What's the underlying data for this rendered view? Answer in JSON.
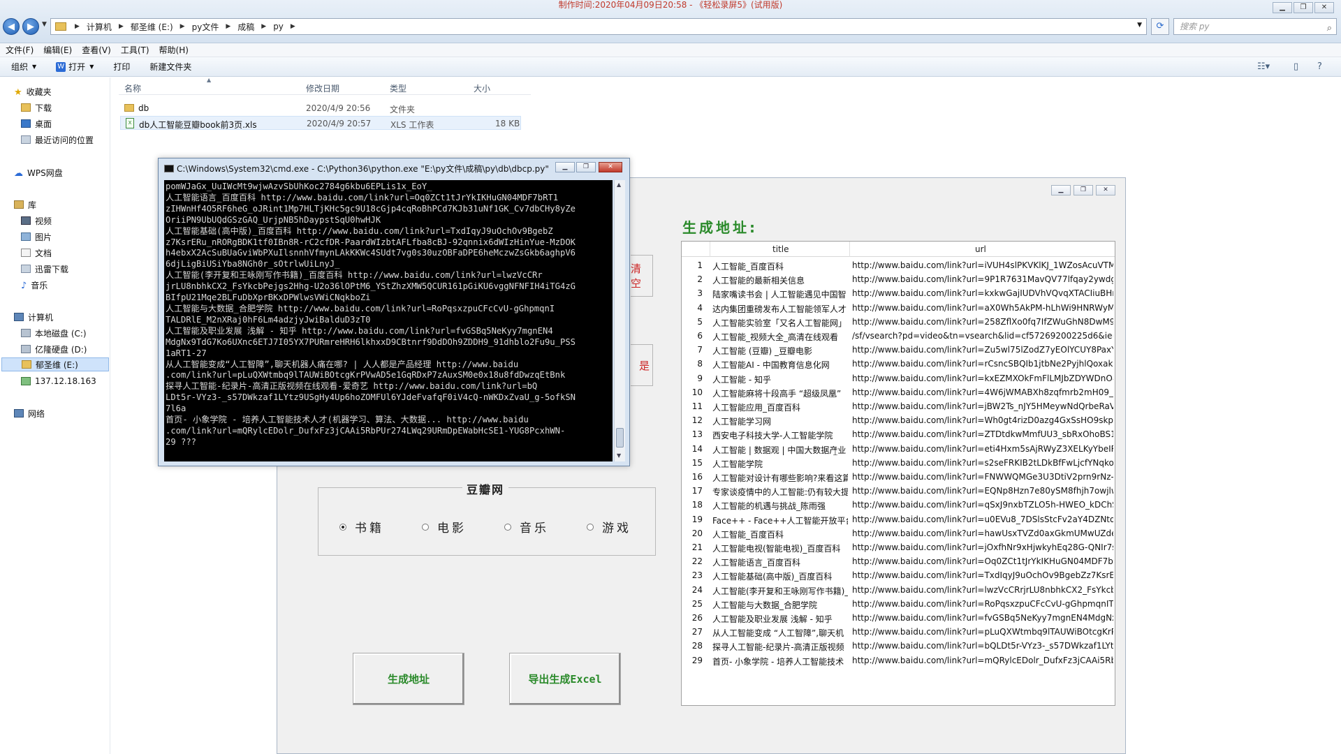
{
  "recording_caption": "制作时间:2020年04月09日20:58 - 《轻松录屏5》(试用版)",
  "explorer": {
    "breadcrumb": [
      "计算机",
      "郁圣维 (E:)",
      "py文件",
      "成稿",
      "py"
    ],
    "search_placeholder": "搜索 py",
    "menu": [
      "文件(F)",
      "编辑(E)",
      "查看(V)",
      "工具(T)",
      "帮助(H)"
    ],
    "toolbar": {
      "organize": "组织",
      "open": "打开",
      "print": "打印",
      "new_folder": "新建文件夹"
    },
    "sidebar": {
      "favorites": "收藏夹",
      "downloads": "下载",
      "desktop": "桌面",
      "recent": "最近访问的位置",
      "wps": "WPS网盘",
      "library": "库",
      "video": "视频",
      "pictures": "图片",
      "documents": "文档",
      "thunder": "迅雷下载",
      "music": "音乐",
      "computer": "计算机",
      "drive_c": "本地磁盘 (C:)",
      "drive_d": "亿隆硬盘 (D:)",
      "drive_e": "郁圣维 (E:)",
      "network_drive": "137.12.18.163",
      "network": "网络"
    },
    "columns": {
      "name": "名称",
      "modified": "修改日期",
      "type": "类型",
      "size": "大小"
    },
    "files": [
      {
        "name": "db",
        "modified": "2020/4/9 20:56",
        "type": "文件夹",
        "size": ""
      },
      {
        "name": "db人工智能豆瓣book前3页.xls",
        "modified": "2020/4/9 20:57",
        "type": "XLS 工作表",
        "size": "18 KB"
      }
    ]
  },
  "cmd": {
    "title": "C:\\Windows\\System32\\cmd.exe - C:\\Python36\\python.exe  \"E:\\py文件\\成稿\\py\\db\\dbcp.py\"",
    "lines": [
      "pomWJaGx_UuIWcMt9wjwAzvSbUhKoc2784g6kbu6EPLis1x_EoY_",
      "人工智能语言_百度百科 http://www.baidu.com/link?url=Oq0ZCt1tJrYkIKHuGN04MDF7bRT1",
      "zIHWnHf4O5RF6heG_oJRint1Mp7HLTjKHc5gc9U18cGjp4cqRoBhPCd7KJb31uNf1GK_Cv7dbCHy8yZe",
      "OriiPN9UbUQdGSzGAQ_UrjpNB5hDaypstSqU0hwHJK",
      "人工智能基础(高中版)_百度百科 http://www.baidu.com/link?url=TxdIqyJ9uOchOv9BgebZ",
      "z7KsrERu_nRORgBDK1tf0IBn8R-rC2cfDR-PaardWIzbtAFLfba8cBJ-92qnnix6dWIzHinYue-MzDOK",
      "h4ebxX2AcSuBUaGviWbPXuIlsnnhVfmynLAkKKWc4SUdt7vg0s30uzOBFaDPE6heMczwZsGkb6aghpV6",
      "6djLigBiUSiYba8NGh0r_sOtrlwUiLnyJ_",
      "人工智能(李开复和王咏刚写作书籍)_百度百科 http://www.baidu.com/link?url=lwzVcCRr",
      "jrLU8nbhkCX2_FsYkcbPejgs2Hhg-U2o36lOPtM6_YStZhzXMW5QCUR161pGiKU6vggNFNFIH4iTG4zG",
      "BIfpU21Mqe2BLFuDbXprBKxDPWlwsVWiCNqkboZi",
      "人工智能与大数据_合肥学院 http://www.baidu.com/link?url=RoPqsxzpuCFcCvU-gGhpmqnI",
      "TALDRlE_M2nXRaj0hF6Lm4adzjyJwiBalduD3zT0",
      "人工智能及职业发展 浅解 - 知乎 http://www.baidu.com/link?url=fvGSBq5NeKyy7mgnEN4",
      "MdgNx9TdG7Ko6UXnc6ETJ7I05YX7PURmreHRH6lkhxxD9CBtnrf9DdDOh9ZDDH9_91dhblo2Fu9u_PSS",
      "1aRT1-27",
      "从人工智能变成“人工智障”,聊天机器人痛在哪? | 人人都是产品经理 http://www.baidu",
      ".com/link?url=pLuQXWtmbq9lTAUWiBOtcgKrPVwAD5e1GqRDxP7zAuxSM0e0x18u8fdDwzqEtBnk",
      "探寻人工智能-纪录片-高清正版视频在线观看-爱奇艺 http://www.baidu.com/link?url=bQ",
      "LDt5r-VYz3-_s57DWkzaf1LYtz9USgHy4Up6hoZOMFUl6YJdeFvafqF0iV4cQ-nWKDxZvaU_g-5ofkSN",
      "7l6a",
      "首页- 小象学院 - 培养人工智能技术人才(机器学习、算法、大数据... http://www.baidu",
      ".com/link?url=mQRylcEDolr_DufxFz3jCAAi5RbPUr274LWq29URmDpEWabHcSE1-YUG8PcxhWN-",
      "29 ???"
    ]
  },
  "app": {
    "section_title": "生成地址:",
    "side_buttons": [
      "清空",
      "是"
    ],
    "group_title": "豆瓣网",
    "radio_options": [
      {
        "label": "书籍",
        "selected": true
      },
      {
        "label": "电影",
        "selected": false
      },
      {
        "label": "音乐",
        "selected": false
      },
      {
        "label": "游戏",
        "selected": false
      }
    ],
    "btn_generate": "生成地址",
    "btn_export": "导出生成Excel",
    "table": {
      "col_title": "title",
      "col_url": "url",
      "rows": [
        {
          "n": "1",
          "title": "人工智能_百度百科",
          "url": "http://www.baidu.com/link?url=iVUH4slPKVKlKJ_1WZosAcuVTMO"
        },
        {
          "n": "2",
          "title": "人工智能的最新相关信息",
          "url": "http://www.baidu.com/link?url=9P1R7631MavQV77lfqay2ywdgo!"
        },
        {
          "n": "3",
          "title": "陆家嘴读书会 | 人工智能遇见中国智",
          "url": "http://www.baidu.com/link?url=kxkwGajIUDVhVQvqXTACIiuBHnu"
        },
        {
          "n": "4",
          "title": "达内集团重磅发布人工智能领军人才",
          "url": "http://www.baidu.com/link?url=aX0Wh5AkPM-hLhWi9HNRWyMJ"
        },
        {
          "n": "5",
          "title": "人工智能实验室「又名人工智能网」",
          "url": "http://www.baidu.com/link?url=258ZflXo0fq7IfZWuGhN8DwM9f2"
        },
        {
          "n": "6",
          "title": "人工智能_视频大全_高清在线观看",
          "url": "/sf/vsearch?pd=video&tn=vsearch&lid=cf57269200225d6&ie="
        },
        {
          "n": "7",
          "title": "人工智能 (豆瓣) _豆瓣电影",
          "url": "http://www.baidu.com/link?url=Zu5wl75lZodZ7yEOlYCUY8PaxYyjj"
        },
        {
          "n": "8",
          "title": "人工智能AI - 中国教育信息化网",
          "url": "http://www.baidu.com/link?url=rCsncSBQIb1jtbNe2PyjhlQoxakrD"
        },
        {
          "n": "9",
          "title": "人工智能 - 知乎",
          "url": "http://www.baidu.com/link?url=kxEZMXOkFmFlLMJbZDYWDnO8"
        },
        {
          "n": "10",
          "title": "人工智能麻将十段高手 “超级凤凰”",
          "url": "http://www.baidu.com/link?url=4W6jWMABXh8zqfmrb2mH09_A("
        },
        {
          "n": "11",
          "title": "人工智能应用_百度百科",
          "url": "http://www.baidu.com/link?url=jBW2Ts_nJY5HMeywNdQrbeRaV"
        },
        {
          "n": "12",
          "title": "人工智能学习网",
          "url": "http://www.baidu.com/link?url=Wh0gt4rizD0azg4GxSsHO9skpX5"
        },
        {
          "n": "13",
          "title": "西安电子科技大学-人工智能学院",
          "url": "http://www.baidu.com/link?url=ZTDtdkwMmfUU3_sbRxOhoBS1w"
        },
        {
          "n": "14",
          "title": "人工智能 | 数据观 | 中国大数据产业",
          "url": "http://www.baidu.com/link?url=eti4Hxm5sAjRWyZ3XELKyYbeIRcE"
        },
        {
          "n": "15",
          "title": "人工智能学院",
          "url": "http://www.baidu.com/link?url=s2seFRKIB2tLDkBfFwLjcfYNqkoU'"
        },
        {
          "n": "16",
          "title": "人工智能对设计有哪些影响?来看这篇",
          "url": "http://www.baidu.com/link?url=FNWWQMGe3U3DtiV2prn9rNz-I"
        },
        {
          "n": "17",
          "title": "专家谈疫情中的人工智能:仍有较大提",
          "url": "http://www.baidu.com/link?url=EQNp8Hzn7e80ySM8fhjh7owjlwv"
        },
        {
          "n": "18",
          "title": "人工智能的机遇与挑战_陈雨强",
          "url": "http://www.baidu.com/link?url=qSxJ9nxbTZLO5h-HWEO_kDChS_"
        },
        {
          "n": "19",
          "title": "Face++ - Face++人工智能开放平台",
          "url": "http://www.baidu.com/link?url=u0EVu8_7DSlsStcFv2aY4DZNtoLr("
        },
        {
          "n": "20",
          "title": "人工智能_百度百科",
          "url": "http://www.baidu.com/link?url=hawUsxTVZd0axGkmUMwUZdee"
        },
        {
          "n": "21",
          "title": "人工智能电视(智能电视)_百度百科",
          "url": "http://www.baidu.com/link?url=jOxfhNr9xHjwkyhEq28G-QNIr7sL"
        },
        {
          "n": "22",
          "title": "人工智能语言_百度百科",
          "url": "http://www.baidu.com/link?url=Oq0ZCt1tJrYkIKHuGN04MDF7bR"
        },
        {
          "n": "23",
          "title": "人工智能基础(高中版)_百度百科",
          "url": "http://www.baidu.com/link?url=TxdIqyJ9uOchOv9BgebZz7KsrER"
        },
        {
          "n": "24",
          "title": "人工智能(李开复和王咏刚写作书籍)_",
          "url": "http://www.baidu.com/link?url=lwzVcCRrjrLU8nbhkCX2_FsYkcbPe"
        },
        {
          "n": "25",
          "title": "人工智能与大数据_合肥学院",
          "url": "http://www.baidu.com/link?url=RoPqsxzpuCFcCvU-gGhpmqnITA"
        },
        {
          "n": "26",
          "title": "人工智能及职业发展 浅解 - 知乎",
          "url": "http://www.baidu.com/link?url=fvGSBq5NeKyy7mgnEN4MdgNx!"
        },
        {
          "n": "27",
          "title": "从人工智能变成 “人工智障”,聊天机",
          "url": "http://www.baidu.com/link?url=pLuQXWtmbq9lTAUWiBOtcgKrP\\"
        },
        {
          "n": "28",
          "title": "探寻人工智能-纪录片-高清正版视频",
          "url": "http://www.baidu.com/link?url=bQLDt5r-VYz3-_s57DWkzaf1LYtz!"
        },
        {
          "n": "29",
          "title": "首页- 小象学院 - 培养人工智能技术",
          "url": "http://www.baidu.com/link?url=mQRylcEDolr_DufxFz3jCAAi5RbPU"
        }
      ]
    }
  },
  "colors": {
    "accent_green": "#2a8a2a",
    "accent_red": "#cc2222",
    "selection": "#cfe3fb"
  }
}
